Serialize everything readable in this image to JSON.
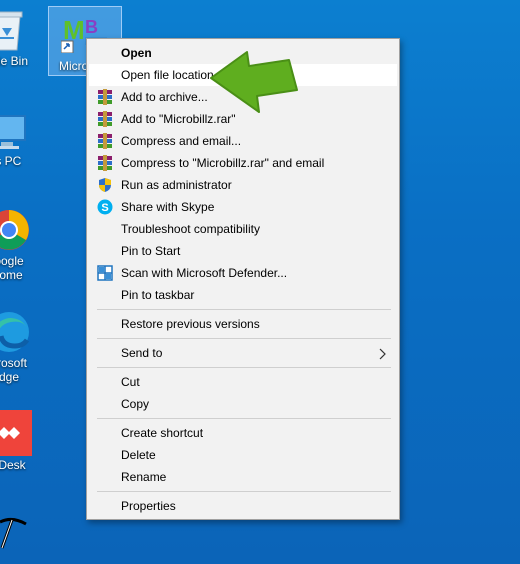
{
  "desktop": {
    "icons": [
      {
        "label": "ycle Bin"
      },
      {
        "label": "Micro"
      },
      {
        "label": "is PC"
      },
      {
        "label1": "oogle",
        "label2": "rome"
      },
      {
        "label1": "crosoft",
        "label2": "dge"
      },
      {
        "label": "yDesk"
      }
    ]
  },
  "context_menu": {
    "items": [
      {
        "label": "Open"
      },
      {
        "label": "Open file location"
      },
      {
        "label": "Add to archive..."
      },
      {
        "label": "Add to \"Microbillz.rar\""
      },
      {
        "label": "Compress and email..."
      },
      {
        "label": "Compress to \"Microbillz.rar\" and email"
      },
      {
        "label": "Run as administrator"
      },
      {
        "label": "Share with Skype"
      },
      {
        "label": "Troubleshoot compatibility"
      },
      {
        "label": "Pin to Start"
      },
      {
        "label": "Scan with Microsoft Defender..."
      },
      {
        "label": "Pin to taskbar"
      },
      {
        "label": "Restore previous versions"
      },
      {
        "label": "Send to"
      },
      {
        "label": "Cut"
      },
      {
        "label": "Copy"
      },
      {
        "label": "Create shortcut"
      },
      {
        "label": "Delete"
      },
      {
        "label": "Rename"
      },
      {
        "label": "Properties"
      }
    ]
  },
  "colors": {
    "desktop_bg": "#0a6fc4",
    "menu_bg": "#f2f2f2",
    "arrow_green": "#5fae1f"
  },
  "app_icon_letters": {
    "m": "M",
    "b": "B"
  }
}
